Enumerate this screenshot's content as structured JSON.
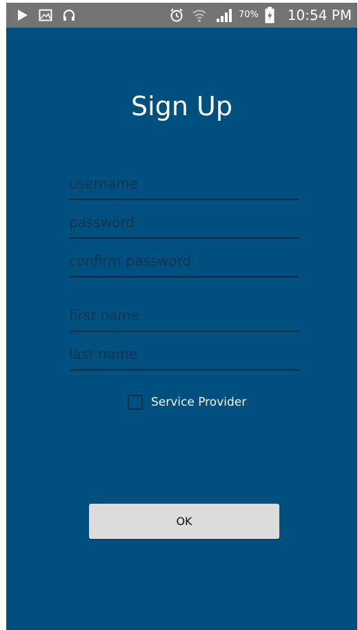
{
  "status_bar": {
    "icons": [
      "play-icon",
      "image-icon",
      "headphones-icon",
      "alarm-icon",
      "wifi-icon",
      "signal-icon",
      "battery-charging-icon"
    ],
    "battery_percent": "70%",
    "time": "10:54 PM"
  },
  "form": {
    "title": "Sign Up",
    "username_placeholder": "username",
    "password_placeholder": "password",
    "confirm_password_placeholder": "confirm password",
    "first_name_placeholder": "first name",
    "last_name_placeholder": "last name",
    "service_provider_label": "Service Provider",
    "service_provider_checked": false,
    "ok_label": "OK"
  },
  "colors": {
    "background": "#00507f",
    "status_bar": "#737373",
    "field_underline": "#0c2f47",
    "placeholder": "#0d3552",
    "button": "#dcdcdc"
  }
}
